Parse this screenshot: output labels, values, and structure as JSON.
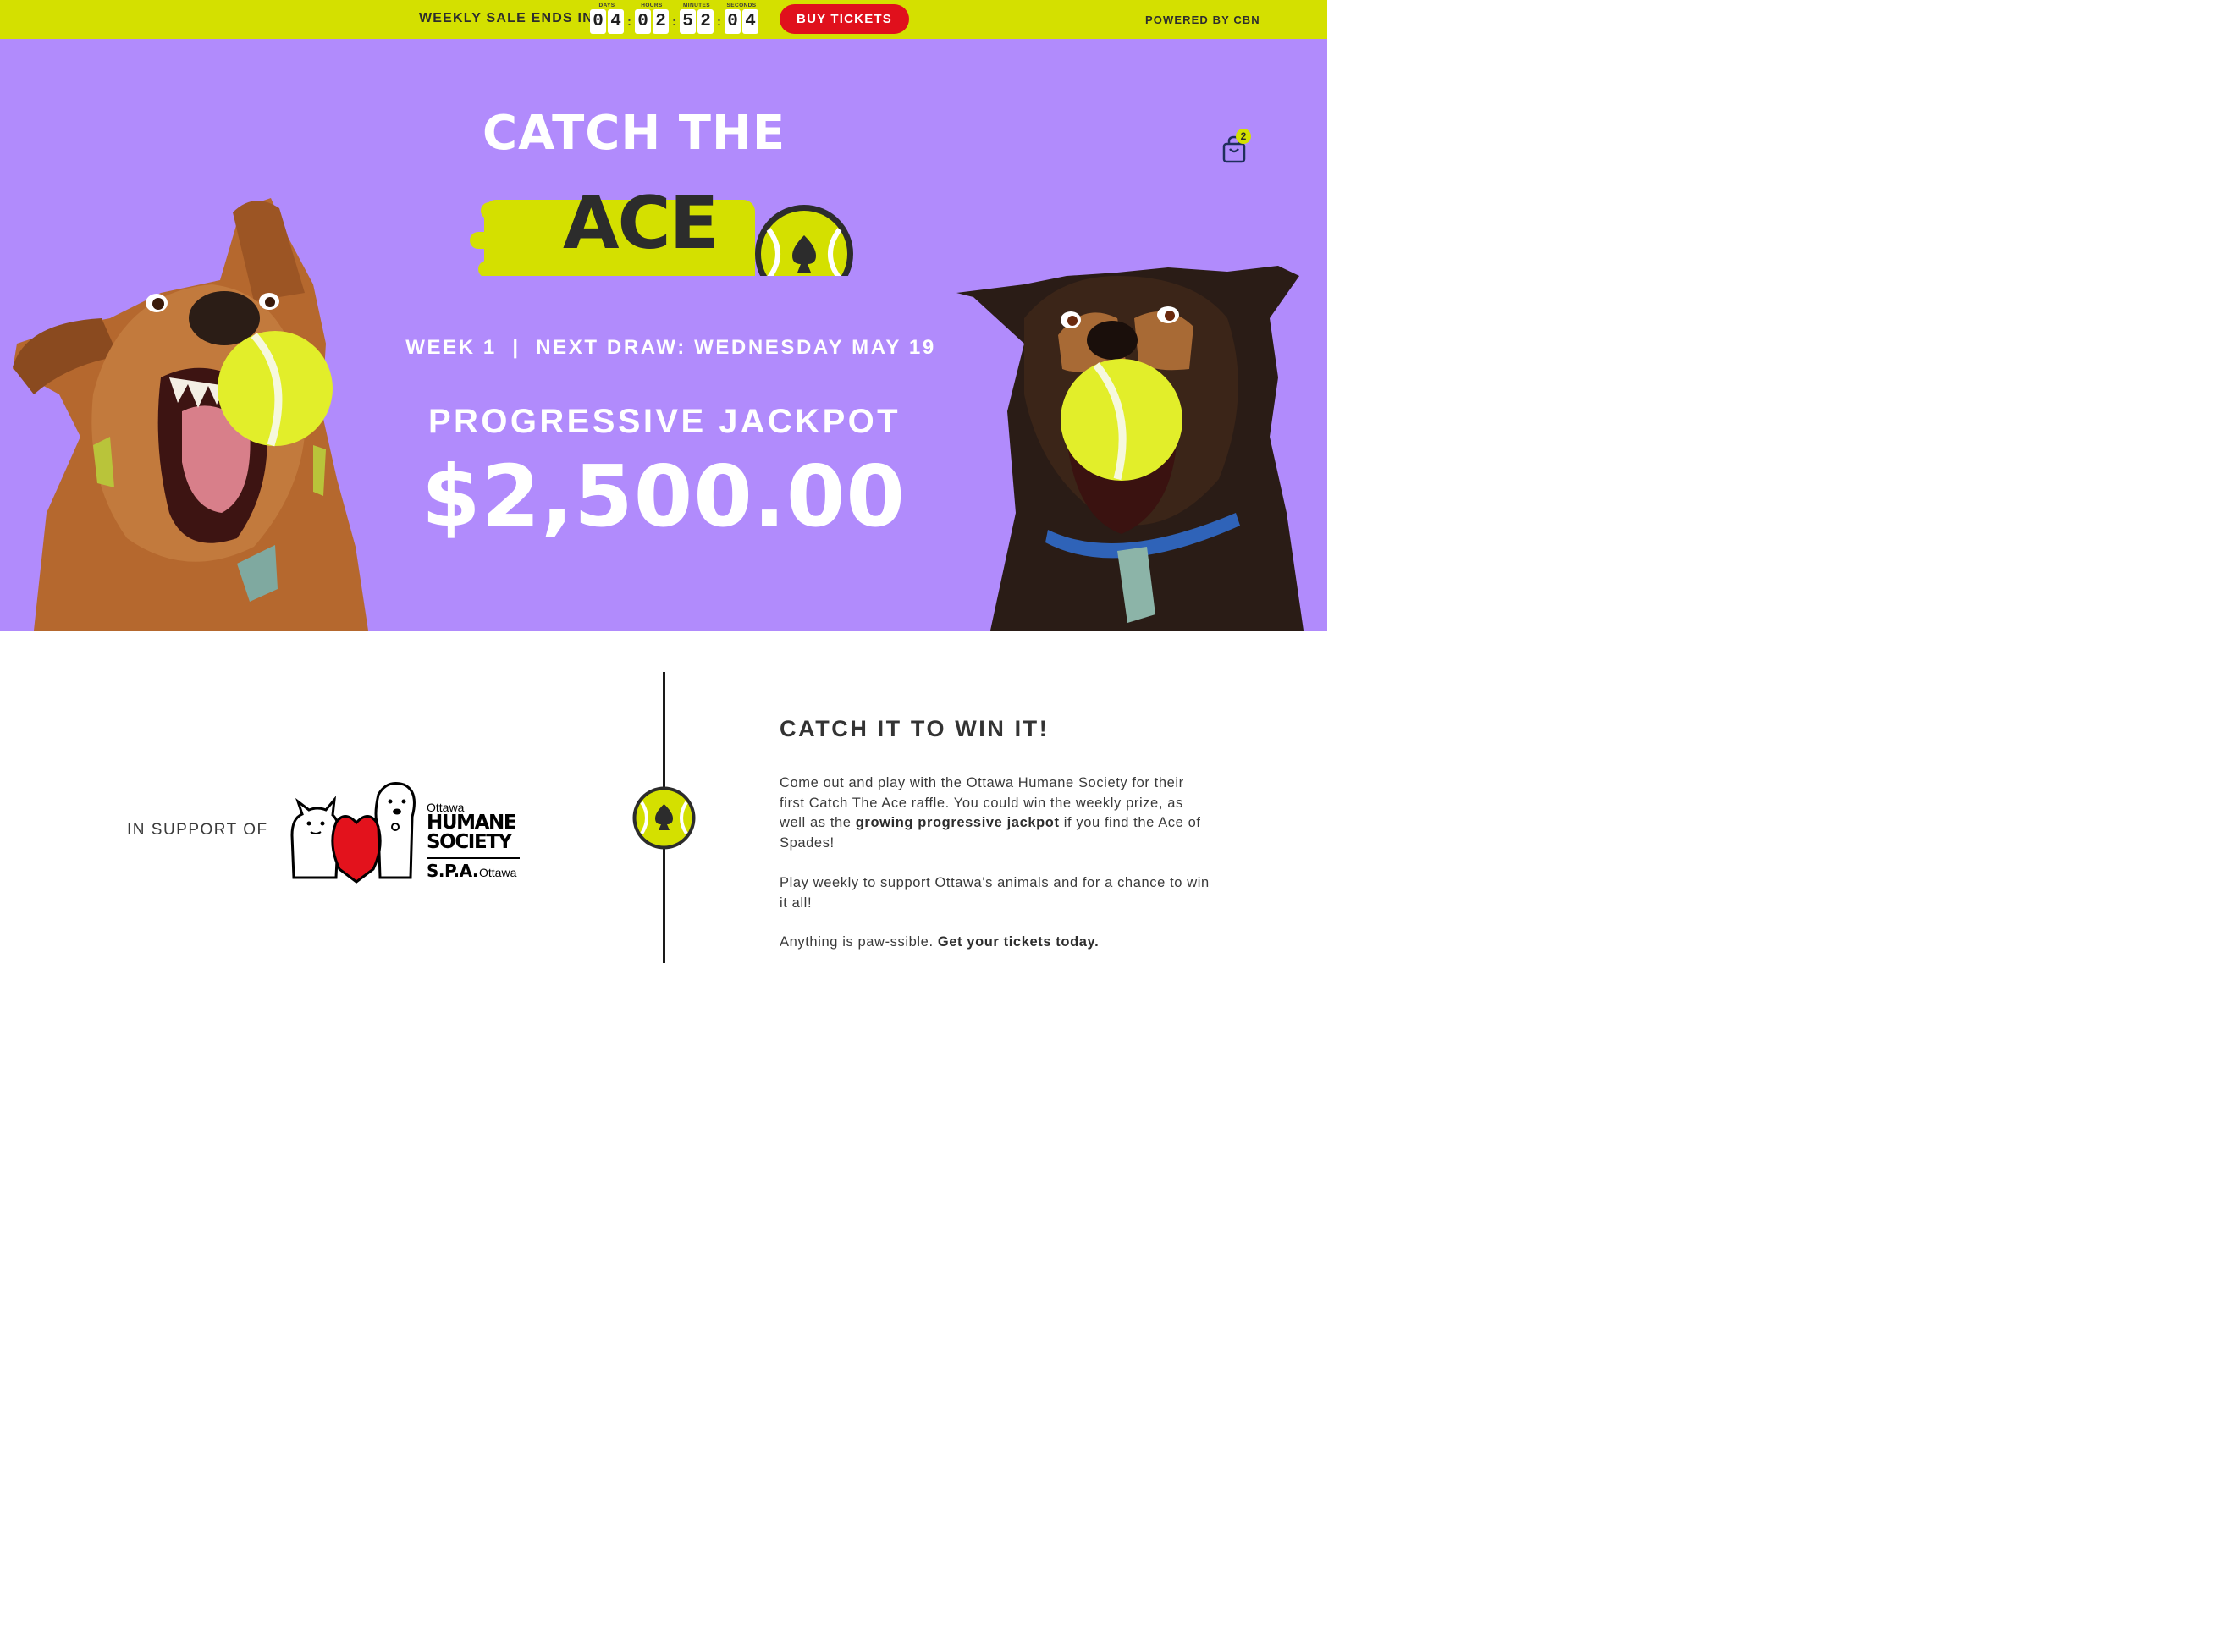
{
  "topbar": {
    "sale_label": "WEEKLY SALE ENDS IN:",
    "countdown": {
      "days_label": "DAYS",
      "days": [
        "0",
        "4"
      ],
      "hours_label": "HOURS",
      "hours": [
        "0",
        "2"
      ],
      "minutes_label": "MINUTES",
      "minutes": [
        "5",
        "2"
      ],
      "seconds_label": "SECONDS",
      "seconds": [
        "0",
        "4"
      ],
      "separator": ":"
    },
    "buy_label": "BUY TICKETS",
    "powered_by": "POWERED BY CBN"
  },
  "hero": {
    "logo_top": "CATCH THE",
    "logo_main": "ACE",
    "cart_count": "2",
    "draw_line": "WEEK 1  |  NEXT DRAW: WEDNESDAY MAY 19",
    "jackpot_label": "PROGRESSIVE JACKPOT",
    "jackpot_amount": "$2,500.00"
  },
  "support": {
    "label": "IN SUPPORT OF",
    "logo": {
      "ottawa_top": "Ottawa",
      "humane": "HUMANE",
      "society": "SOCIETY",
      "spa": "S.P.A.",
      "ottawa_bottom": "Ottawa"
    }
  },
  "info": {
    "title": "CATCH IT TO WIN IT!",
    "p1_a": "Come out and play with the Ottawa Humane Society for their first Catch The Ace raffle. You could win the weekly prize, as well as the ",
    "p1_bold": "growing progressive jackpot",
    "p1_b": " if you find the Ace of Spades!",
    "p2": "Play weekly to support Ottawa's animals and for a chance to win it all!",
    "p3_a": "Anything is paw-ssible. ",
    "p3_bold": "Get your tickets today."
  },
  "colors": {
    "brand_lime": "#d4e000",
    "hero_purple": "#b18bfc",
    "button_red": "#e0101c",
    "dark_text": "#2d2d2d"
  },
  "icons": [
    "cart-icon",
    "tennis-ball-spade-icon",
    "spade-icon"
  ]
}
